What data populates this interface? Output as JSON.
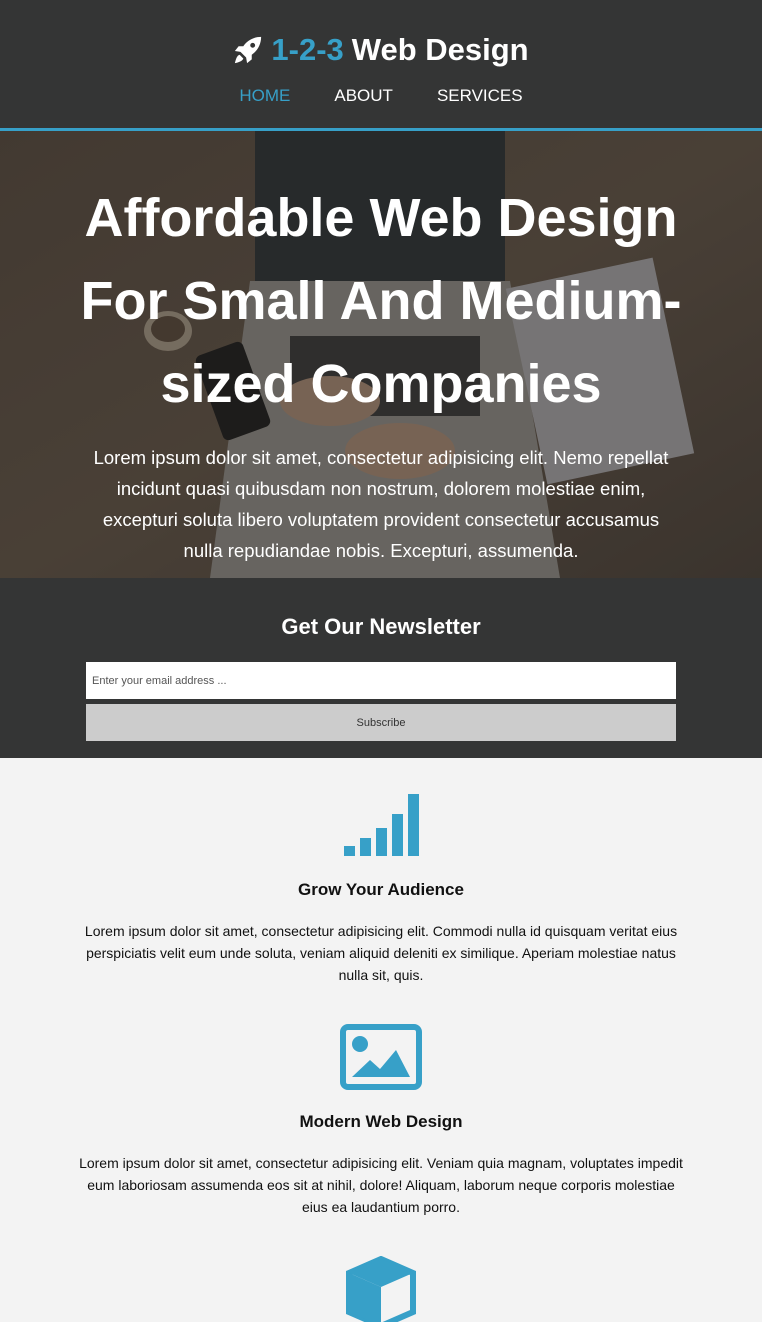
{
  "brand": {
    "accent": "1-2-3",
    "name": "Web Design",
    "icon": "rocket-icon"
  },
  "nav": {
    "items": [
      {
        "label": "HOME",
        "active": true
      },
      {
        "label": "ABOUT",
        "active": false
      },
      {
        "label": "SERVICES",
        "active": false
      }
    ]
  },
  "hero": {
    "title": "Affordable Web Design For Small And Medium-sized Companies",
    "text": "Lorem ipsum dolor sit amet, consectetur adipisicing elit. Nemo repellat incidunt quasi quibusdam non nostrum, dolorem molestiae enim, excepturi soluta libero voluptatem provident consectetur accusamus nulla repudiandae nobis. Excepturi, assumenda."
  },
  "newsletter": {
    "title": "Get Our Newsletter",
    "placeholder": "Enter your email address ...",
    "button": "Subscribe"
  },
  "features": [
    {
      "icon": "bar-chart-icon",
      "title": "Grow Your Audience",
      "text": "Lorem ipsum dolor sit amet, consectetur adipisicing elit. Commodi nulla id quisquam veritat eius perspiciatis velit eum unde soluta, veniam aliquid deleniti ex similique. Aperiam molestiae natus nulla sit, quis."
    },
    {
      "icon": "image-icon",
      "title": "Modern Web Design",
      "text": "Lorem ipsum dolor sit amet, consectetur adipisicing elit. Veniam quia magnam, voluptates impedit eum laboriosam assumenda eos sit at nihil, dolore! Aliquam, laborum neque corporis molestiae eius ea laudantium porro."
    },
    {
      "icon": "cube-icon"
    }
  ],
  "colors": {
    "accent": "#37a0c8",
    "dark": "#343535",
    "light": "#f3f3f3"
  }
}
